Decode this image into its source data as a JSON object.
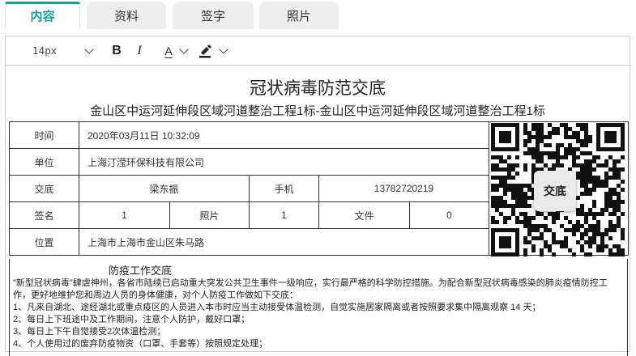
{
  "tabs": [
    {
      "label": "内容",
      "active": true
    },
    {
      "label": "资料",
      "active": false
    },
    {
      "label": "签字",
      "active": false
    },
    {
      "label": "照片",
      "active": false
    }
  ],
  "toolbar": {
    "font_size": "14px",
    "bold": "B",
    "italic": "I",
    "font_color": "A"
  },
  "document": {
    "title": "冠状病毒防范交底",
    "subtitle": "金山区中运河延伸段区域河道整治工程1标-金山区中运河延伸段区域河道整治工程1标",
    "info": {
      "time_label": "时间",
      "time_value": "2020年03月11日 10:32:09",
      "unit_label": "单位",
      "unit_value": "上海汀滢环保科技有限公司",
      "handover_label": "交底",
      "handover_value": "梁东振",
      "phone_label": "手机",
      "phone_value": "13782720219",
      "sign_label": "签名",
      "sign_value": "1",
      "photo_label": "照片",
      "photo_value": "1",
      "file_label": "文件",
      "file_value": "0",
      "location_label": "位置",
      "location_value": "上海市上海市金山区朱马路"
    },
    "qr_badge": "交底",
    "notice_title": "防疫工作交底",
    "notice_lines": [
      "\"新型冠状病毒\"肆虐神州，各省市陆续已启动重大突发公共卫生事件一级响应，实行最严格的科学防控措施。为配合新型冠状病毒感染的肺炎疫情防控工作，更好地维护您和周边人员的身体健康，对个人防疫工作做如下交底：",
      "1、凡来自湖北、途经湖北或重点疫区的人员进入本市时应当主动接受体温检测，自觉实施居家隔离或者按照要求集中隔离观察 14 天；",
      "2、每日上下班途中及工作期间，注意个人防护，戴好口罩；",
      "3、每日上下午自觉接受2次体温检测；",
      "4、个人使用过的废弃防疫物资（口罩、手套等）按照规定处理；"
    ]
  },
  "colors": {
    "accent": "#1aa092",
    "tab_inactive": "#eeeeee",
    "border": "#333333"
  },
  "icons": [
    "chevron-down-icon",
    "font-color-icon",
    "highlight-pen-icon",
    "qr-code"
  ]
}
